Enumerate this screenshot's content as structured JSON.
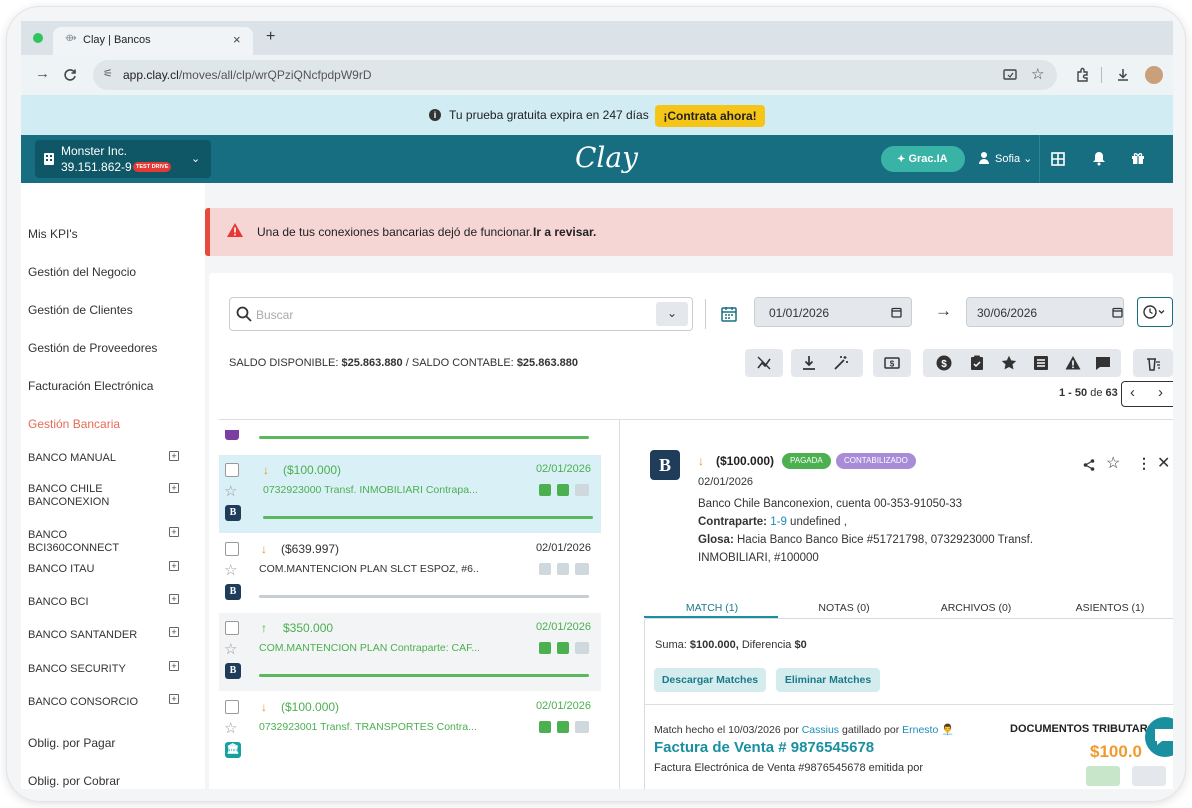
{
  "browser": {
    "tab_title": "Clay | Bancos",
    "tab_close": "×",
    "new_tab": "+",
    "url_host": "app.clay.cl",
    "url_path": "/moves/all/clp/wrQPziQNcfpdpW9rD"
  },
  "trial": {
    "text": "Tu prueba gratuita expira en 247 días",
    "cta": "¡Contrata ahora!"
  },
  "header": {
    "company_name": "Monster Inc.",
    "company_rut": "39.151.862-9",
    "badge": "TEST DRIVE",
    "logo": "Clay",
    "grac_label": "Grac.IA",
    "user": "Sofia"
  },
  "sidebar": {
    "main_items": [
      "Mis KPI's",
      "Gestión del Negocio",
      "Gestión de Clientes",
      "Gestión de Proveedores",
      "Facturación Electrónica",
      "Gestión Bancaria"
    ],
    "active_color": "#e66a55",
    "banks": [
      "BANCO MANUAL",
      "BANCO CHILE BANCONEXION",
      "BANCO BCI360CONNECT",
      "BANCO ITAU",
      "BANCO BCI",
      "BANCO SANTANDER",
      "BANCO SECURITY",
      "BANCO CONSORCIO"
    ],
    "bottom_items": [
      "Oblig. por Pagar",
      "Oblig. por Cobrar"
    ]
  },
  "alert": {
    "text": "Una de tus conexiones bancarias dejó de funcionar.",
    "link": "Ir a revisar."
  },
  "toolbar": {
    "search_placeholder": "Buscar",
    "date_from": "01/01/2026",
    "date_to": "30/06/2026",
    "arrow": "→",
    "saldo_disp_label": "SALDO DISPONIBLE:",
    "saldo_disp_value": "$25.863.880",
    "saldo_sep": "/",
    "saldo_cont_label": "SALDO CONTABLE:",
    "saldo_cont_value": "$25.863.880",
    "pagination_range": "1 - 50",
    "pagination_of": "de",
    "pagination_total": "63"
  },
  "moves": [
    {
      "arrow": "↓",
      "amount": "($100.000)",
      "date": "02/01/2026",
      "desc": "0732923000 Transf. INMOBILIARI Contrapa...",
      "amount_color": "#4caf50",
      "selected": true,
      "matched": true,
      "bank": "B"
    },
    {
      "arrow": "↓",
      "amount": "($639.997)",
      "date": "02/01/2026",
      "desc": "COM.MANTENCION PLAN SLCT ESPOZ, #6...",
      "amount_color": "#333333",
      "selected": false,
      "matched": false,
      "bank": "B"
    },
    {
      "arrow": "↑",
      "amount": "$350.000",
      "date": "02/01/2026",
      "desc": "COM.MANTENCION PLAN Contraparte: CAF...",
      "amount_color": "#4caf50",
      "selected": false,
      "matched": true,
      "bank": "B"
    },
    {
      "arrow": "↓",
      "amount": "($100.000)",
      "date": "02/01/2026",
      "desc": "0732923001 Transf. TRANSPORTES Contra...",
      "amount_color": "#4caf50",
      "selected": false,
      "matched": true,
      "bank": "🏛"
    }
  ],
  "detail": {
    "arrow": "↓",
    "amount": "($100.000)",
    "badge_paid": "PAGADA",
    "badge_accounted": "CONTABILIZADO",
    "date": "02/01/2026",
    "account": "Banco Chile Banconexion, cuenta 00-353-91050-33",
    "contraparte_label": "Contraparte:",
    "contraparte_link": "1-9",
    "contraparte_rest": "undefined ,",
    "glosa_label": "Glosa:",
    "glosa_line1": "Hacia Banco Banco Bice #51721798, 0732923000 Transf.",
    "glosa_line2": "INMOBILIARI, #100000",
    "tabs": [
      "MATCH (1)",
      "NOTAS (0)",
      "ARCHIVOS (0)",
      "ASIENTOS (1)"
    ],
    "suma_label": "Suma:",
    "suma_value": "$100.000,",
    "diff_label": "Diferencia",
    "diff_value": "$0",
    "btn_download": "Descargar Matches",
    "btn_delete": "Eliminar Matches",
    "match_prefix": "Match hecho el 10/03/2026 por",
    "match_user": "Cassius",
    "match_mid": "gatillado por",
    "match_trigger": "Ernesto",
    "doc_header": "DOCUMENTOS TRIBUTAR",
    "invoice_title": "Factura de Venta # 9876545678",
    "invoice_amount": "$100.0",
    "invoice_sub": "Factura Electrónica de Venta #9876545678 emitida por"
  }
}
